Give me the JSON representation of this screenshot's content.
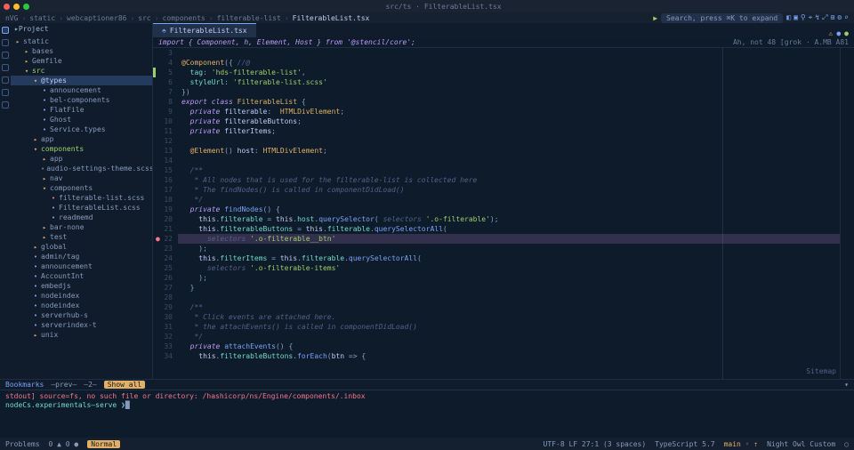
{
  "title": "src/ts · FilterableList.tsx",
  "crumbs": [
    "nVG",
    "static",
    "webcaptioner86",
    "src",
    "components",
    "filterable-list",
    "FilterableList.tsx"
  ],
  "search_placeholder": "Search, press ⌘K to expand",
  "sidebar": {
    "header": "Project",
    "items": [
      {
        "d": 0,
        "icon": "▸",
        "cls": "fold",
        "label": "static"
      },
      {
        "d": 1,
        "icon": "▸",
        "cls": "fold",
        "label": "bases"
      },
      {
        "d": 1,
        "icon": "▸",
        "cls": "fold",
        "label": "Gemfile"
      },
      {
        "d": 1,
        "icon": "▾",
        "cls": "fold",
        "label": "src",
        "grn": 1
      },
      {
        "d": 2,
        "icon": "▾",
        "cls": "fold",
        "label": "@types",
        "sel": 1
      },
      {
        "d": 3,
        "icon": " ",
        "cls": "ts",
        "label": "announcement"
      },
      {
        "d": 3,
        "icon": " ",
        "cls": "ts",
        "label": "bel-components"
      },
      {
        "d": 3,
        "icon": " ",
        "cls": "ts",
        "label": "FlatFile"
      },
      {
        "d": 3,
        "icon": " ",
        "cls": "ts",
        "label": "Ghost"
      },
      {
        "d": 3,
        "icon": " ",
        "cls": "ts",
        "label": "Service.types"
      },
      {
        "d": 2,
        "icon": "▸",
        "cls": "fold",
        "label": "app"
      },
      {
        "d": 2,
        "icon": "▾",
        "cls": "fold",
        "label": "components",
        "grn": 1
      },
      {
        "d": 3,
        "icon": "▸",
        "cls": "fold",
        "label": "app"
      },
      {
        "d": 3,
        "icon": " ",
        "cls": "txt",
        "label": "audio-settings-theme.scss"
      },
      {
        "d": 3,
        "icon": "▸",
        "cls": "fold",
        "label": "nav"
      },
      {
        "d": 3,
        "icon": "▾",
        "cls": "fold",
        "label": "components"
      },
      {
        "d": 4,
        "icon": " ",
        "cls": "scss",
        "label": "filterable-list.scss"
      },
      {
        "d": 4,
        "icon": " ",
        "cls": "ts",
        "label": "FilterableList.scss"
      },
      {
        "d": 4,
        "icon": " ",
        "cls": "ts",
        "label": "readmemd"
      },
      {
        "d": 3,
        "icon": "▸",
        "cls": "fold",
        "label": "bar-none"
      },
      {
        "d": 3,
        "icon": "▸",
        "cls": "fold",
        "label": "test"
      },
      {
        "d": 2,
        "icon": "▸",
        "cls": "fold",
        "label": "global"
      },
      {
        "d": 2,
        "icon": " ",
        "cls": "ts",
        "label": "admin/tag"
      },
      {
        "d": 2,
        "icon": " ",
        "cls": "ts",
        "label": "announcement"
      },
      {
        "d": 2,
        "icon": " ",
        "cls": "ts",
        "label": "AccountInt"
      },
      {
        "d": 2,
        "icon": " ",
        "cls": "ts",
        "label": "embedjs"
      },
      {
        "d": 2,
        "icon": " ",
        "cls": "ts",
        "label": "nodeindex"
      },
      {
        "d": 2,
        "icon": " ",
        "cls": "ts",
        "label": "nodeindex"
      },
      {
        "d": 2,
        "icon": " ",
        "cls": "ts",
        "label": "serverhub-s"
      },
      {
        "d": 2,
        "icon": " ",
        "cls": "ts",
        "label": "serverindex-t"
      },
      {
        "d": 2,
        "icon": "▸",
        "cls": "fold",
        "label": "unix"
      }
    ]
  },
  "tab": {
    "label": "FilterableList.tsx"
  },
  "tab_meta": [
    "⚠",
    "●",
    "●"
  ],
  "code_info_left": "import { Component, h, Element, Host } from '@stencil/core';",
  "code_info_right": "Ah, not 48  [grok · A.MB A81",
  "lines": [
    {
      "n": 3,
      "html": ""
    },
    {
      "n": 4,
      "html": "<span class='dec'>@Component</span><span class='pun'>({</span> <span class='cmt'>//@</span>"
    },
    {
      "n": 5,
      "html": "  <span class='prop'>tag</span><span class='pun'>:</span> <span class='str'>'hds-filterable-list'</span><span class='pun'>,</span>",
      "flag": "g"
    },
    {
      "n": 6,
      "html": "  <span class='prop'>styleUrl</span><span class='pun'>:</span> <span class='str'>'filterable-list.scss'</span>"
    },
    {
      "n": 7,
      "html": "<span class='pun'>})</span>"
    },
    {
      "n": 8,
      "html": "<span class='kw'>export class</span> <span class='cls'>FilterableList</span> <span class='pun'>{</span>"
    },
    {
      "n": 9,
      "html": "  <span class='kw'>private</span> <span class='var'>filterable</span><span class='pun'>:</span>  <span class='cls'>HTMLDivElement</span><span class='pun'>;</span>"
    },
    {
      "n": 10,
      "html": "  <span class='kw'>private</span> <span class='var'>filterableButtons</span><span class='pun'>;</span>"
    },
    {
      "n": 11,
      "html": "  <span class='kw'>private</span> <span class='var'>filterItems</span><span class='pun'>;</span>"
    },
    {
      "n": 12,
      "html": ""
    },
    {
      "n": 13,
      "html": "  <span class='dec'>@Element</span><span class='pun'>()</span> <span class='var'>host</span><span class='pun'>:</span> <span class='cls'>HTMLDivElement</span><span class='pun'>;</span>"
    },
    {
      "n": 14,
      "html": ""
    },
    {
      "n": 15,
      "html": "  <span class='cmt'>/**</span>"
    },
    {
      "n": 16,
      "html": "  <span class='cmt'> * All nodes that is used for the filterable-list is collected here</span>"
    },
    {
      "n": 17,
      "html": "  <span class='cmt'> * The findNodes() is called in componentDidLoad()</span>"
    },
    {
      "n": 18,
      "html": "  <span class='cmt'> */</span>"
    },
    {
      "n": 19,
      "html": "  <span class='kw'>private</span> <span class='fn'>findNodes</span><span class='pun'>()</span> <span class='pun'>{</span>"
    },
    {
      "n": 20,
      "html": "    <span class='var'>this</span><span class='pun'>.</span><span class='prop'>filterable</span> <span class='pun'>=</span> <span class='var'>this</span><span class='pun'>.</span><span class='prop'>host</span><span class='pun'>.</span><span class='fn'>querySelector</span><span class='pun'>(</span> <span class='cmt'>selectors</span> <span class='str'>'.o-filterable'</span><span class='pun'>);</span>"
    },
    {
      "n": 21,
      "html": "    <span class='var'>this</span><span class='pun'>.</span><span class='prop'>filterableButtons</span> <span class='pun'>=</span> <span class='var'>this</span><span class='pun'>.</span><span class='prop'>filterable</span><span class='pun'>.</span><span class='fn'>querySelectorAll</span><span class='pun'>(</span>"
    },
    {
      "n": 22,
      "html": "      <span class='cmt'>selectors</span> <span class='str'>'.o-filterable__btn'</span>",
      "hl": 1,
      "bp": 1
    },
    {
      "n": 23,
      "html": "    <span class='pun'>);</span>"
    },
    {
      "n": 24,
      "html": "    <span class='var'>this</span><span class='pun'>.</span><span class='prop'>filterItems</span> <span class='pun'>=</span> <span class='var'>this</span><span class='pun'>.</span><span class='prop'>filterable</span><span class='pun'>.</span><span class='fn'>querySelectorAll</span><span class='pun'>(</span>"
    },
    {
      "n": 25,
      "html": "      <span class='cmt'>selectors</span> <span class='str'>'.o-filterable-items'</span>"
    },
    {
      "n": 26,
      "html": "    <span class='pun'>);</span>"
    },
    {
      "n": 27,
      "html": "  <span class='pun'>}</span>"
    },
    {
      "n": 28,
      "html": ""
    },
    {
      "n": 29,
      "html": "  <span class='cmt'>/**</span>"
    },
    {
      "n": 30,
      "html": "  <span class='cmt'> * Click events are attached here.</span>"
    },
    {
      "n": 31,
      "html": "  <span class='cmt'> * the attachEvents() is called in componentDidLoad()</span>"
    },
    {
      "n": 32,
      "html": "  <span class='cmt'> */</span>"
    },
    {
      "n": 33,
      "html": "  <span class='kw'>private</span> <span class='fn'>attachEvents</span><span class='pun'>()</span> <span class='pun'>{</span>"
    },
    {
      "n": 34,
      "html": "    <span class='var'>this</span><span class='pun'>.</span><span class='prop'>filterableButtons</span><span class='pun'>.</span><span class='fn'>forEach</span><span class='pun'>(</span><span class='var'>btn</span> <span class='pun'>=&gt;</span> <span class='pun'>{</span>"
    }
  ],
  "marks": {
    "left": "Bookmarks",
    "prev": "—prev—",
    "next": "—2—",
    "show": "Show all"
  },
  "terminal": {
    "l1": "stdout] source=fs, no such file or directory: /hashicorp/ns/Engine/components/.inbox",
    "l2": "nodeCs.experimentals–serve ❯",
    "cursor": "█"
  },
  "status": {
    "left1": "Problems",
    "left2": "0 ▲  0 ●",
    "left3": "Normal",
    "r1": "UTF-8  LF  27:1 (3 spaces)",
    "r2": "TypeScript 5.7",
    "r3": "main ◦ ⇡",
    "r4": "Night Owl Custom",
    "r5": "○"
  },
  "sitemap": "Sitemap"
}
